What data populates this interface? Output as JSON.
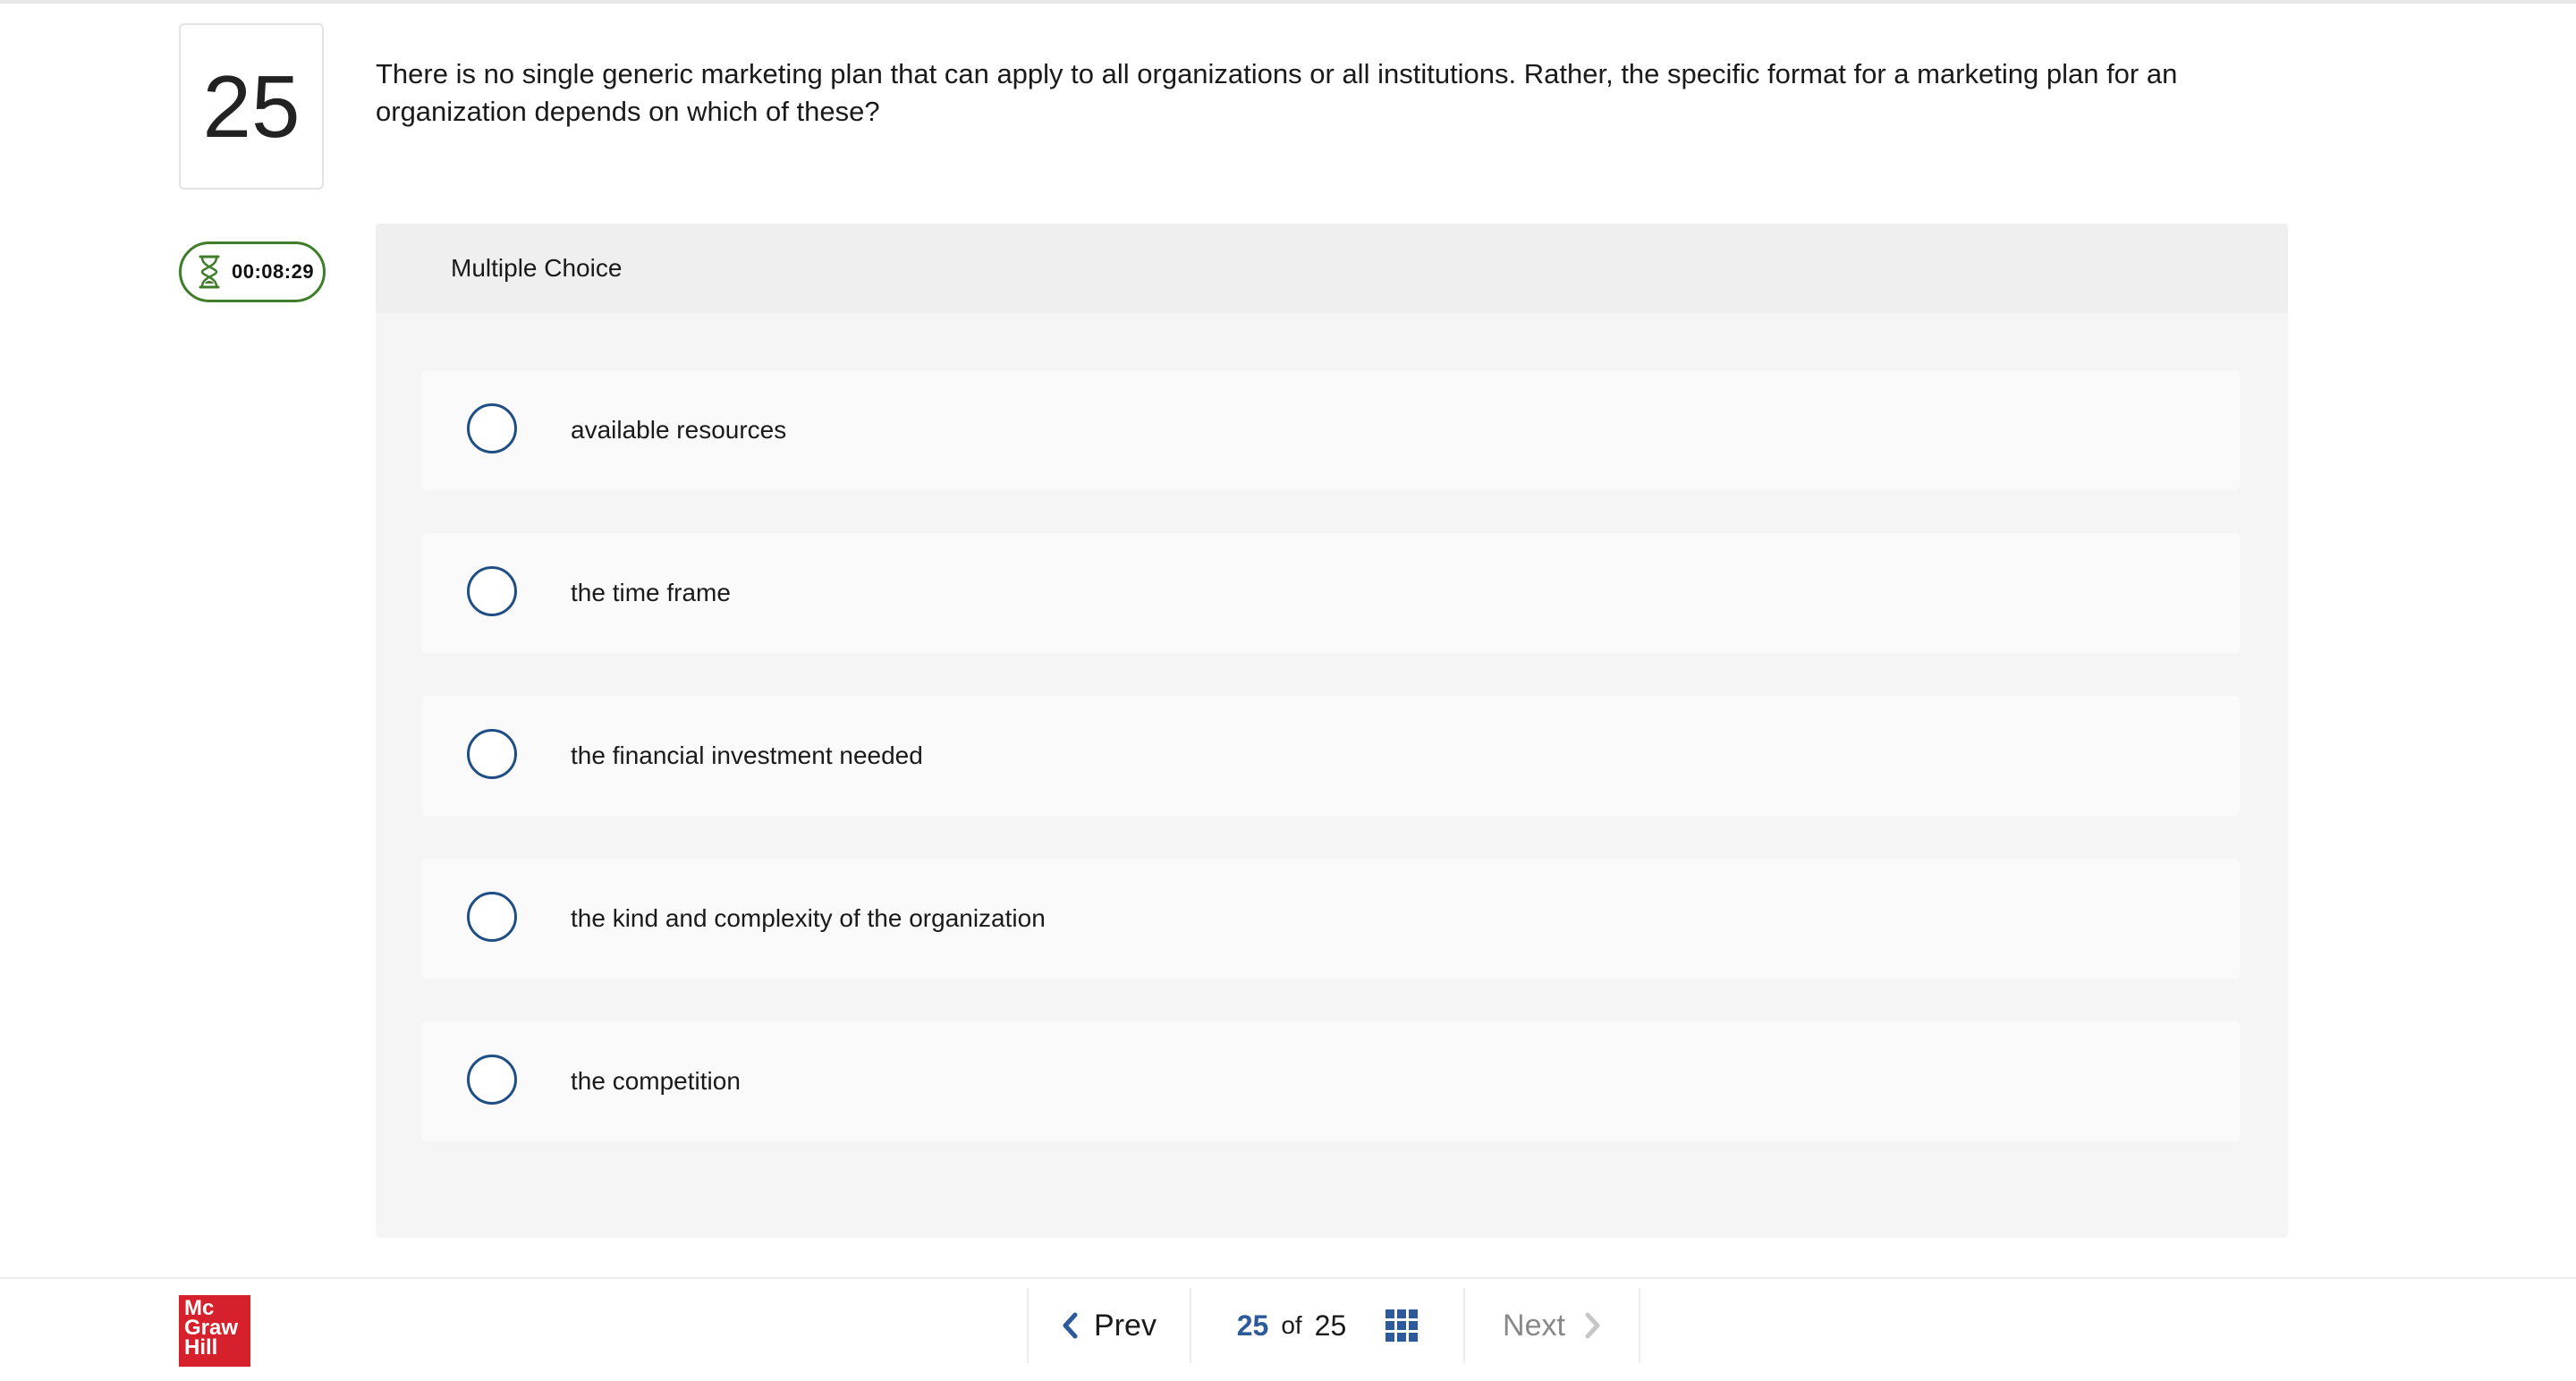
{
  "question": {
    "number": "25",
    "text": "There is no single generic marketing plan that can apply to all organizations or all institutions. Rather, the specific format for a marketing plan for an organization depends on which of these?"
  },
  "timer": {
    "time": "00:08:29",
    "icon": "hourglass-icon"
  },
  "multiple_choice": {
    "header": "Multiple Choice",
    "options": [
      {
        "label": "available resources"
      },
      {
        "label": "the time frame"
      },
      {
        "label": "the financial investment needed"
      },
      {
        "label": "the kind and complexity of the organization"
      },
      {
        "label": "the competition"
      }
    ]
  },
  "footer": {
    "logo": {
      "line1": "Mc",
      "line2": "Graw",
      "line3": "Hill"
    },
    "prev_label": "Prev",
    "next_label": "Next",
    "current_page": "25",
    "of_label": "of",
    "total_pages": "25"
  },
  "colors": {
    "accent": "#2d5a9a",
    "radio_border": "#1f4e85",
    "timer_border": "#3f7d2a",
    "logo_red": "#d6202c"
  }
}
